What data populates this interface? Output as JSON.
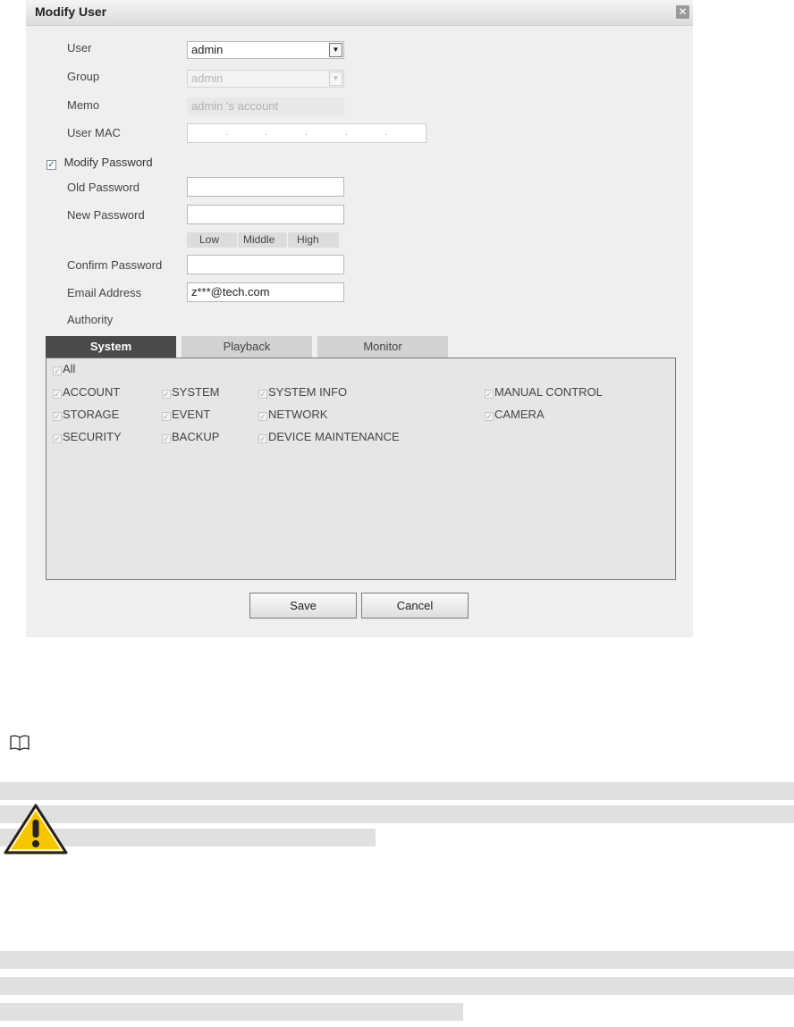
{
  "dialog": {
    "title": "Modify User",
    "close_icon": "close-icon"
  },
  "form": {
    "user_label": "User",
    "user_value": "admin",
    "group_label": "Group",
    "group_value": "admin",
    "memo_label": "Memo",
    "memo_value": "admin 's account",
    "mac_label": "User MAC",
    "mac_separators": [
      ".",
      ".",
      ".",
      ".",
      "."
    ],
    "modify_password_label": "Modify Password",
    "modify_password_checked": true,
    "old_password_label": "Old Password",
    "new_password_label": "New Password",
    "strength": [
      "Low",
      "Middle",
      "High"
    ],
    "confirm_password_label": "Confirm Password",
    "email_label": "Email Address",
    "email_value": "z***@tech.com",
    "authority_label": "Authority"
  },
  "tabs": [
    {
      "label": "System",
      "active": true
    },
    {
      "label": "Playback",
      "active": false
    },
    {
      "label": "Monitor",
      "active": false
    }
  ],
  "permissions": {
    "all": "All",
    "items": [
      "ACCOUNT",
      "SYSTEM",
      "SYSTEM INFO",
      "MANUAL CONTROL",
      "STORAGE",
      "EVENT",
      "NETWORK",
      "CAMERA",
      "SECURITY",
      "BACKUP",
      "DEVICE MAINTENANCE"
    ]
  },
  "buttons": {
    "save": "Save",
    "cancel": "Cancel"
  },
  "icons": {
    "note": "book-icon",
    "warning": "warning-icon"
  },
  "colors": {
    "active_tab": "#4a4a4a",
    "check_mark": "#1d5fb7",
    "warning_fill": "#f7c600"
  }
}
